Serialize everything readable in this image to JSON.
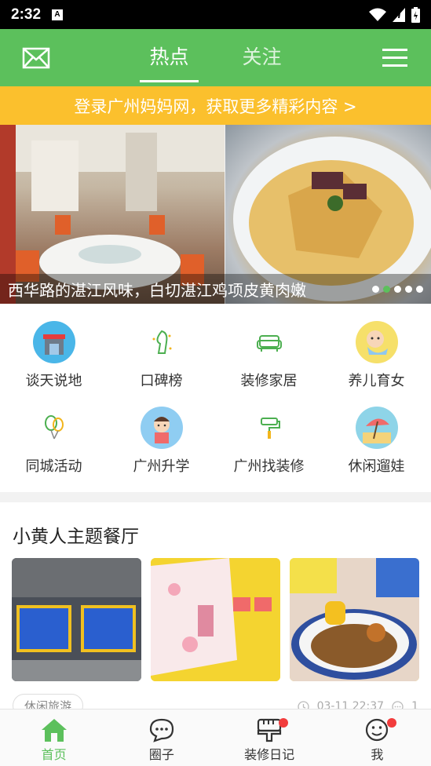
{
  "status_bar": {
    "time": "2:32",
    "a_icon": "A"
  },
  "header": {
    "tabs": [
      {
        "label": "热点",
        "active": true
      },
      {
        "label": "关注",
        "active": false
      }
    ]
  },
  "login_banner": {
    "text": "登录广州妈妈网，获取更多精彩内容 >"
  },
  "carousel": {
    "caption": "西华路的湛江风味，白切湛江鸡项皮黄肉嫩",
    "dot_count": 5,
    "active_dot": 1
  },
  "categories": [
    {
      "label": "谈天说地",
      "icon": "shop-icon"
    },
    {
      "label": "口碑榜",
      "icon": "trophy-icon"
    },
    {
      "label": "装修家居",
      "icon": "sofa-icon"
    },
    {
      "label": "养儿育女",
      "icon": "baby-icon"
    },
    {
      "label": "同城活动",
      "icon": "balloon-icon"
    },
    {
      "label": "广州升学",
      "icon": "student-icon"
    },
    {
      "label": "广州找装修",
      "icon": "paint-roller-icon"
    },
    {
      "label": "休闲遛娃",
      "icon": "beach-umbrella-icon"
    }
  ],
  "section": {
    "title": "小黄人主题餐厅",
    "tag": "休闲旅游",
    "time": "03-11 22:37",
    "comments": "1"
  },
  "bottom_nav": [
    {
      "label": "首页",
      "icon": "home-icon",
      "active": true,
      "badge": false
    },
    {
      "label": "圈子",
      "icon": "chat-icon",
      "active": false,
      "badge": false
    },
    {
      "label": "装修日记",
      "icon": "brush-icon",
      "active": false,
      "badge": true
    },
    {
      "label": "我",
      "icon": "profile-icon",
      "active": false,
      "badge": true
    }
  ],
  "colors": {
    "brand_green": "#5cc05c",
    "banner_yellow": "#fbc02d",
    "badge_red": "#f23c3c"
  }
}
